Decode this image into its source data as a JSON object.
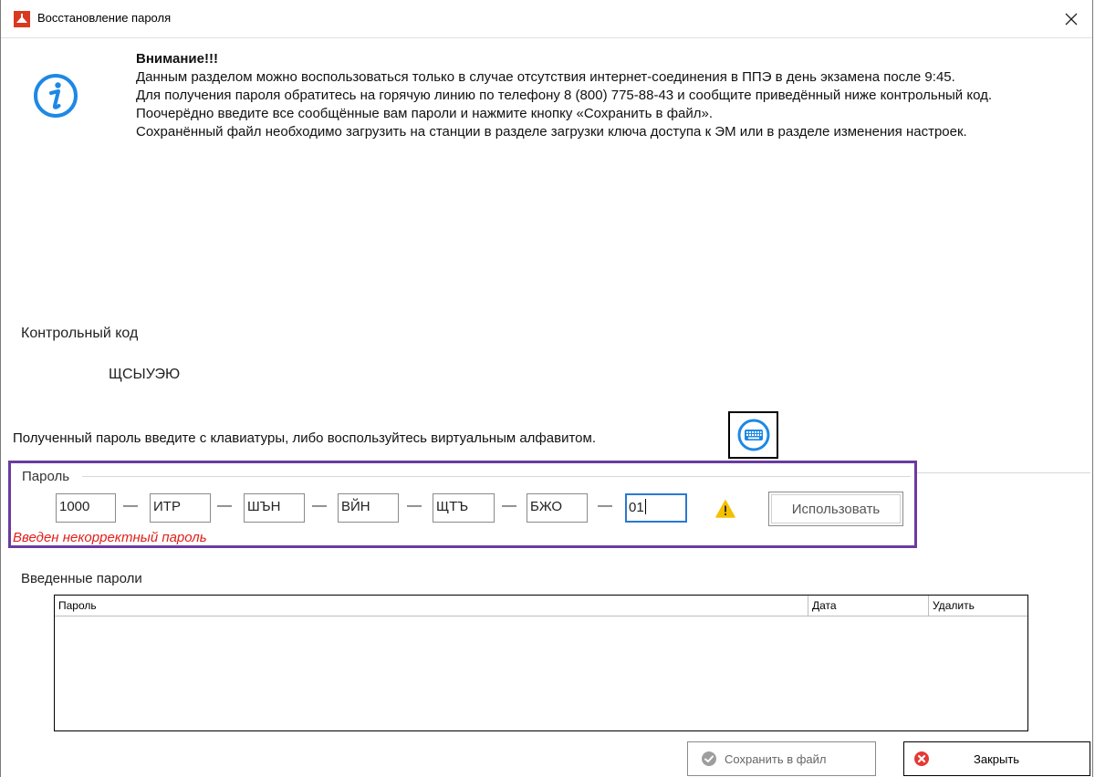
{
  "window": {
    "title": "Восстановление пароля",
    "close_glyph": "✕"
  },
  "notice": {
    "heading": "Внимание!!!",
    "lines": [
      "Данным разделом можно воспользоваться только в случае отсутствия интернет-соединения в ППЭ в день экзамена после 9:45.",
      "Для получения пароля обратитесь на горячую линию по телефону 8 (800) 775-88-43 и сообщите приведённый ниже контрольный код.",
      "Поочерёдно введите все сообщённые вам пароли и нажмите кнопку «Сохранить в файл».",
      "Сохранённый файл необходимо загрузить на станции в разделе загрузки ключа доступа к ЭМ или в разделе изменения настроек."
    ]
  },
  "control_code": {
    "label": "Контрольный код",
    "value": "ЩСЫУЭЮ"
  },
  "hint": "Полученный пароль введите с клавиатуры, либо воспользуйтесь виртуальным алфавитом.",
  "password": {
    "legend": "Пароль",
    "segments": [
      "1000",
      "ИТР",
      "ШЪН",
      "ВЙН",
      "ЩТЪ",
      "БЖО",
      "01"
    ],
    "separator": "—",
    "use_button": "Использовать",
    "error": "Введен некорректный пароль"
  },
  "entered": {
    "label": "Введенные пароли",
    "columns": [
      "Пароль",
      "Дата",
      "Удалить"
    ]
  },
  "footer": {
    "save_button": "Сохранить в файл",
    "close_button": "Закрыть"
  },
  "colors": {
    "highlight_frame": "#6a3ba0",
    "error_text": "#e0201b",
    "info_icon": "#1e88e5",
    "warning": "#f5c000",
    "close_icon": "#e53935"
  },
  "icons": [
    "app-icon",
    "close-icon",
    "info-icon",
    "keyboard-icon",
    "warning-icon",
    "checkmark-icon",
    "error-x-icon"
  ]
}
